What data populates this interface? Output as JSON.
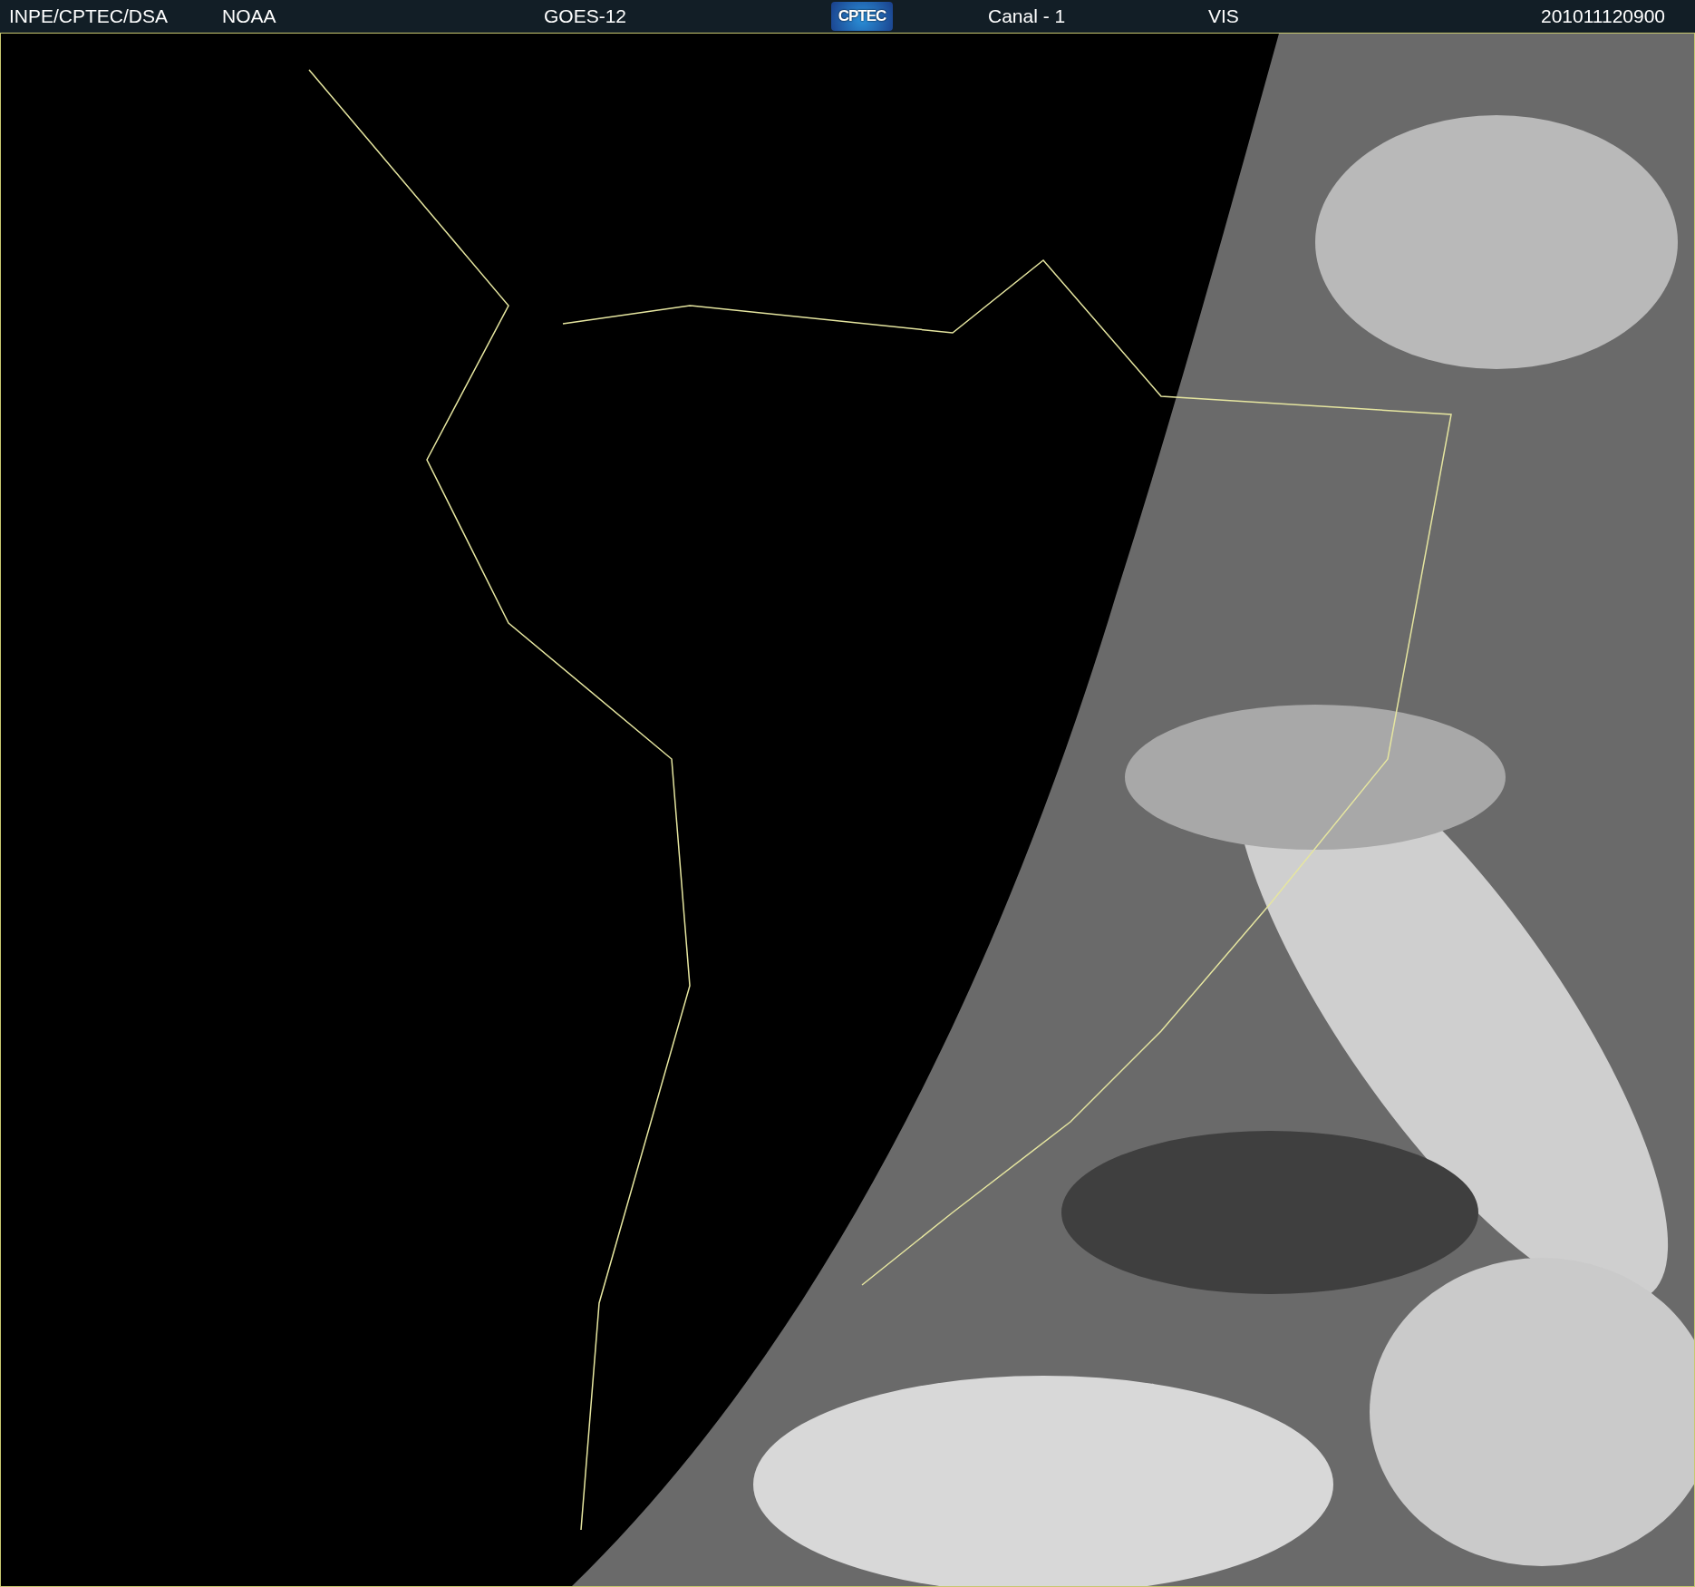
{
  "header": {
    "source": "INPE/CPTEC/DSA",
    "agency": "NOAA",
    "satellite": "GOES-12",
    "logo": "CPTEC",
    "channel": "Canal - 1",
    "band": "VIS",
    "timestamp": "201011120900"
  }
}
